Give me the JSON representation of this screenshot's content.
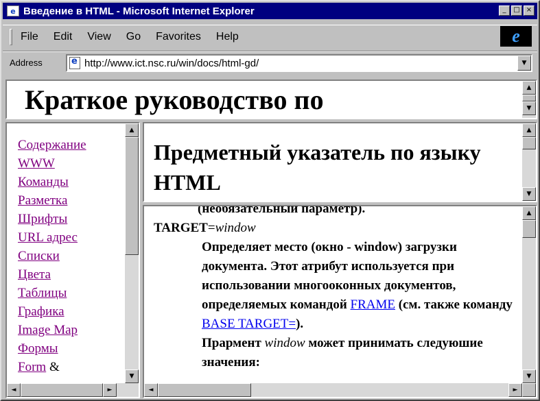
{
  "window": {
    "title": "Введение в HTML - Microsoft Internet Explorer",
    "controls": {
      "minimize": "_",
      "maximize": "□",
      "close": "×"
    }
  },
  "menu": [
    "File",
    "Edit",
    "View",
    "Go",
    "Favorites",
    "Help"
  ],
  "address": {
    "label": "Address",
    "url": "http://www.ict.nsc.ru/win/docs/html-gd/"
  },
  "top_frame": {
    "heading": "Краткое руководство по"
  },
  "subtitle_frame": {
    "heading": "Предметный указатель по языку HTML"
  },
  "nav": {
    "items": [
      "Содержание",
      "WWW",
      "Команды",
      "Разметка",
      "Шрифты",
      "URL адрес",
      "Списки",
      "Цвета",
      "Таблицы",
      "Графика",
      "Image Map",
      "Формы"
    ],
    "last_link": "Form",
    "last_suffix": " &"
  },
  "content": {
    "cut_line": "(необязательный параметр).",
    "term_name": "TARGET",
    "term_eq": "=",
    "term_value": "window",
    "desc_1": "Определяет место (окно - window) загрузки документа. Этот ",
    "desc_1_bold": "атрибут",
    "desc_2": " используется при использовании многооконных документов, определяемых командой ",
    "link_frame": "FRAME",
    "desc_3": " (см. также команду ",
    "link_base": "BASE TARGET=",
    "desc_4": ").",
    "desc_5": "Прармент ",
    "desc_5_italic": "window",
    "desc_6": " может принимать следуюшие значения:"
  },
  "colors": {
    "titlebar": "#000080",
    "visited_link": "#800080",
    "link": "#0000ee",
    "chrome": "#c0c0c0"
  },
  "icons": {
    "app": "ie-page-icon",
    "brand": "ie-logo-icon"
  }
}
